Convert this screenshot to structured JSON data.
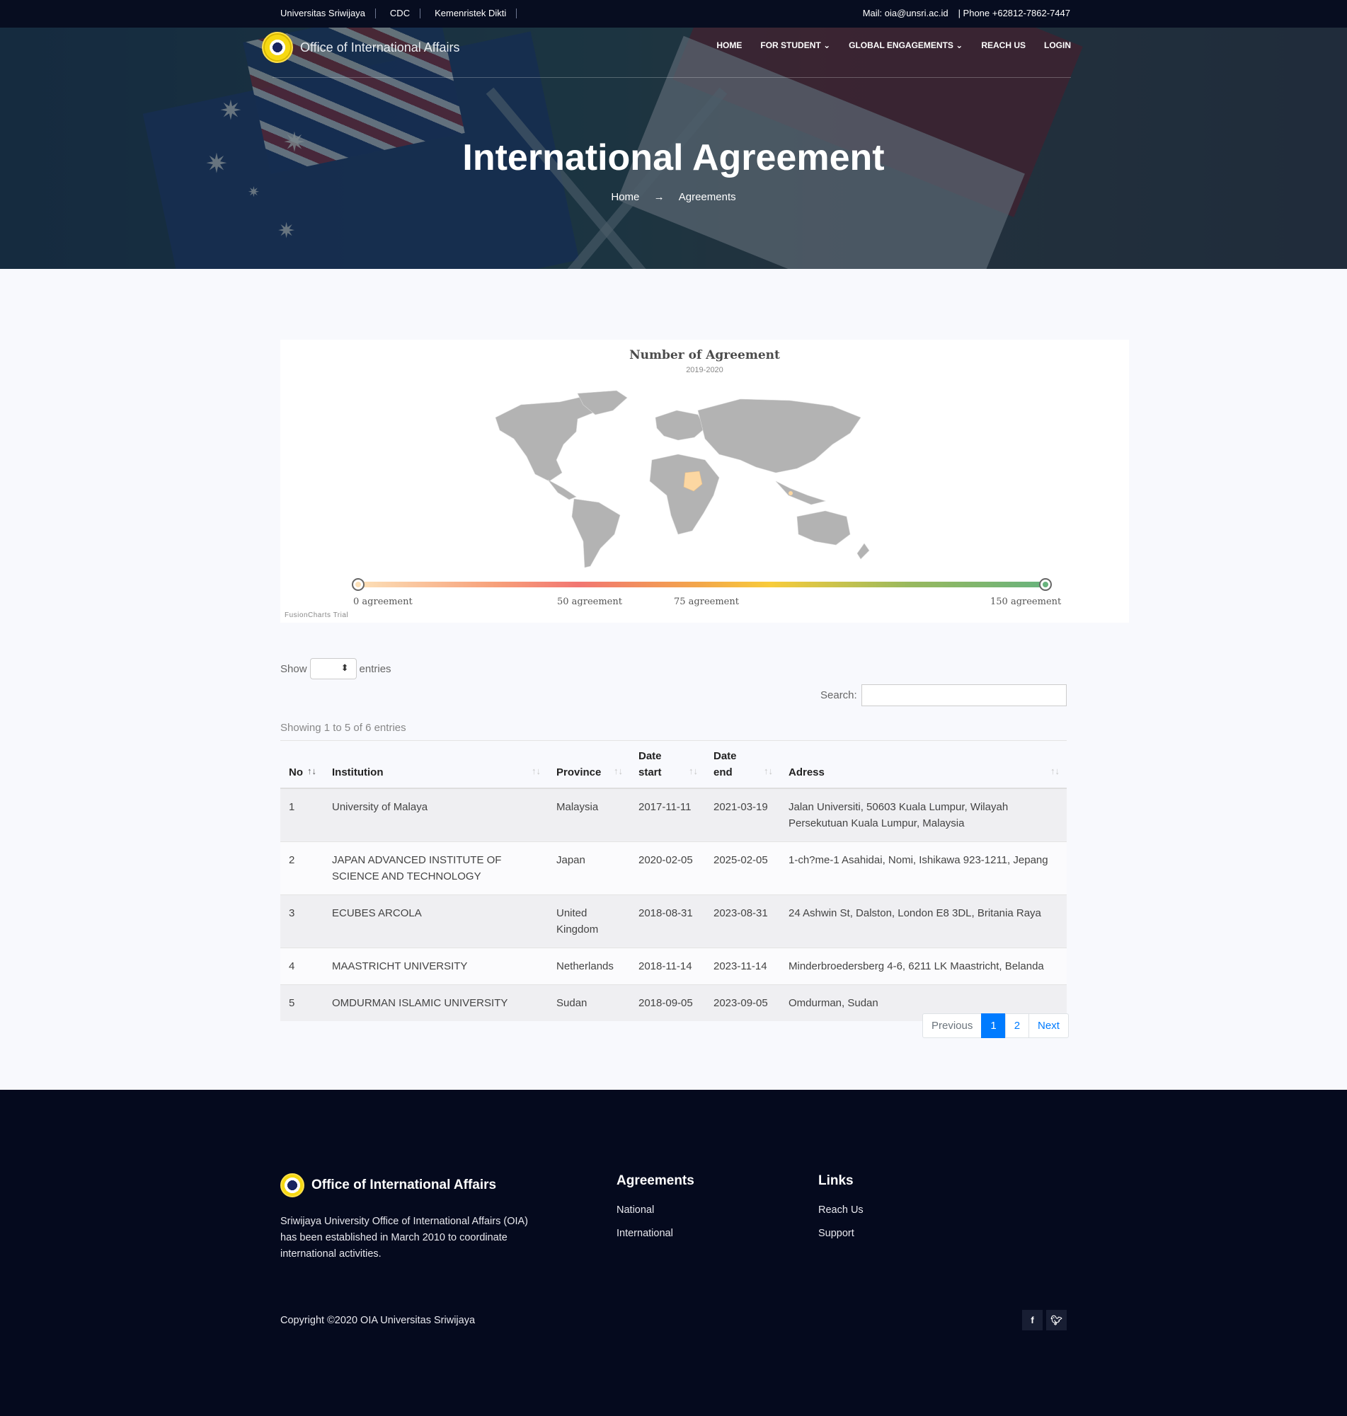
{
  "topbar": {
    "links": [
      "Universitas Sriwijaya",
      "CDC",
      "Kemenristek Dikti"
    ],
    "mail": "Mail: oia@unsri.ac.id",
    "phone": "| Phone +62812-7862-7447"
  },
  "nav": {
    "brand": "Office of International Affairs",
    "items": [
      "HOME",
      "FOR STUDENT",
      "GLOBAL ENGAGEMENTS",
      "REACH US",
      "LOGIN"
    ]
  },
  "hero": {
    "title": "International Agreement",
    "breadcrumb": [
      "Home",
      "Agreements"
    ]
  },
  "chart_data": {
    "type": "map",
    "title": "Number of Agreement",
    "subtitle": "2019-2020",
    "legend_labels": [
      "0 agreement",
      "50 agreement",
      "75 agreement",
      "150 agreement"
    ],
    "legend_stops": [
      0,
      50,
      75,
      150
    ],
    "range": [
      0,
      150
    ],
    "colors": {
      "low": "#fce0b8",
      "mid": "#f27672",
      "high": "#68b37d",
      "land": "#b3b3b3"
    },
    "watermark": "FusionCharts Trial"
  },
  "table_controls": {
    "show_label": "Show",
    "entries_label": "entries",
    "search_label": "Search:",
    "info": "Showing 1 to 5 of 6 entries"
  },
  "table": {
    "columns": [
      "No",
      "Institution",
      "Province",
      "Date start",
      "Date end",
      "Adress"
    ],
    "rows": [
      [
        "1",
        "University of Malaya",
        "Malaysia",
        "2017-11-11",
        "2021-03-19",
        "Jalan Universiti, 50603 Kuala Lumpur, Wilayah Persekutuan Kuala Lumpur, Malaysia"
      ],
      [
        "2",
        "JAPAN ADVANCED INSTITUTE OF SCIENCE AND TECHNOLOGY",
        "Japan",
        "2020-02-05",
        "2025-02-05",
        "1-ch?me-1 Asahidai, Nomi, Ishikawa 923-1211, Jepang"
      ],
      [
        "3",
        "ECUBES ARCOLA",
        "United Kingdom",
        "2018-08-31",
        "2023-08-31",
        "24 Ashwin St, Dalston, London E8 3DL, Britania Raya"
      ],
      [
        "4",
        "MAASTRICHT UNIVERSITY",
        "Netherlands",
        "2018-11-14",
        "2023-11-14",
        "Minderbroedersberg 4-6, 6211 LK Maastricht, Belanda"
      ],
      [
        "5",
        "OMDURMAN ISLAMIC UNIVERSITY",
        "Sudan",
        "2018-09-05",
        "2023-09-05",
        "Omdurman, Sudan"
      ]
    ]
  },
  "pagination": {
    "previous": "Previous",
    "pages": [
      "1",
      "2"
    ],
    "next": "Next",
    "current": "1"
  },
  "footer": {
    "brand": "Office of International Affairs",
    "description": "Sriwijaya University Office of International Affairs (OIA) has been established in March 2010 to coordinate international activities.",
    "agreements_title": "Agreements",
    "agreements_links": [
      "National",
      "International"
    ],
    "links_title": "Links",
    "links": [
      "Reach Us",
      "Support"
    ],
    "copyright": "Copyright ©2020 OIA Universitas Sriwijaya",
    "social": [
      "facebook-icon",
      "twitter-icon"
    ]
  }
}
